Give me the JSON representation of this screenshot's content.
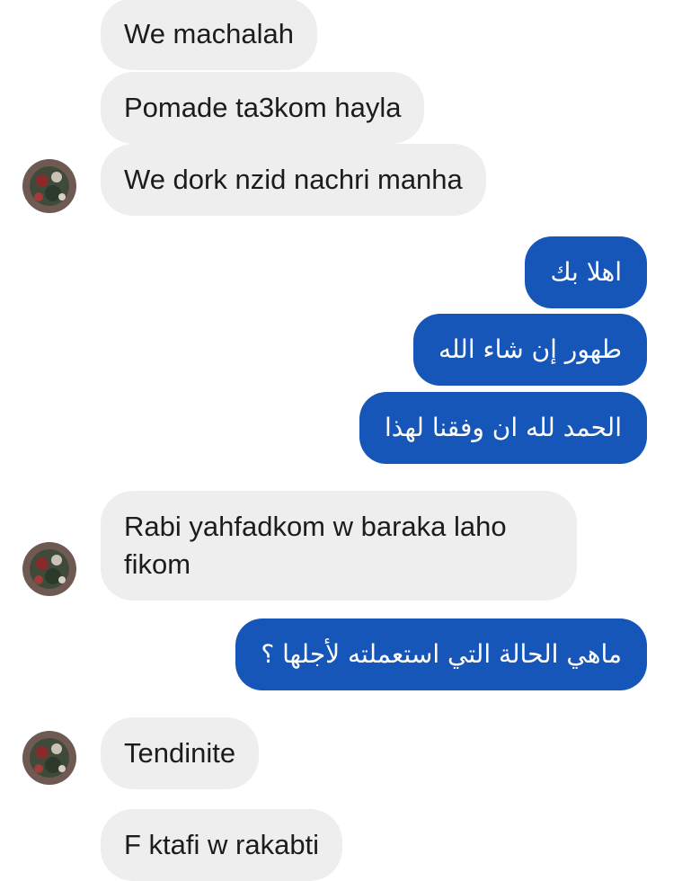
{
  "messages": [
    {
      "text": "We machalah"
    },
    {
      "text": "Pomade ta3kom hayla"
    },
    {
      "text": "We dork nzid nachri manha"
    },
    {
      "text": "اهلا بك"
    },
    {
      "text": "طهور إن شاء الله"
    },
    {
      "text": "الحمد لله ان وفقنا لهذا"
    },
    {
      "text": "Rabi yahfadkom w baraka laho fikom"
    },
    {
      "text": "ماهي الحالة التي استعملته لأجلها ؟"
    },
    {
      "text": "Tendinite"
    },
    {
      "text": "F ktafi w rakabti"
    }
  ],
  "colors": {
    "incoming_bubble": "#eeeeee",
    "outgoing_bubble": "#1656b8",
    "incoming_text": "#1c1c1c",
    "outgoing_text": "#ffffff"
  },
  "icons": {
    "avatar": "contact-avatar-icon"
  }
}
